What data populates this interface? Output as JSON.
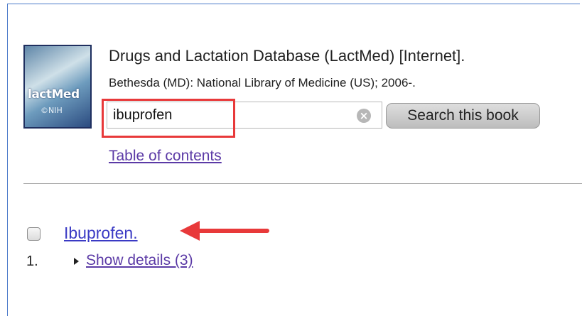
{
  "book": {
    "cover_label": "lactMed",
    "cover_sub": "©NIH",
    "title": "Drugs and Lactation Database (LactMed) [Internet].",
    "publisher": "Bethesda (MD): National Library of Medicine (US); 2006-."
  },
  "search": {
    "value": "ibuprofen",
    "button_label": "Search this book"
  },
  "nav": {
    "toc_label": "Table of contents"
  },
  "results": [
    {
      "title": "Ibuprofen.",
      "number": "1.",
      "details_label": "Show details (3)"
    }
  ],
  "colors": {
    "highlight": "#e8393a",
    "link_visited": "#5b3aa6",
    "link": "#3a3ac4"
  }
}
